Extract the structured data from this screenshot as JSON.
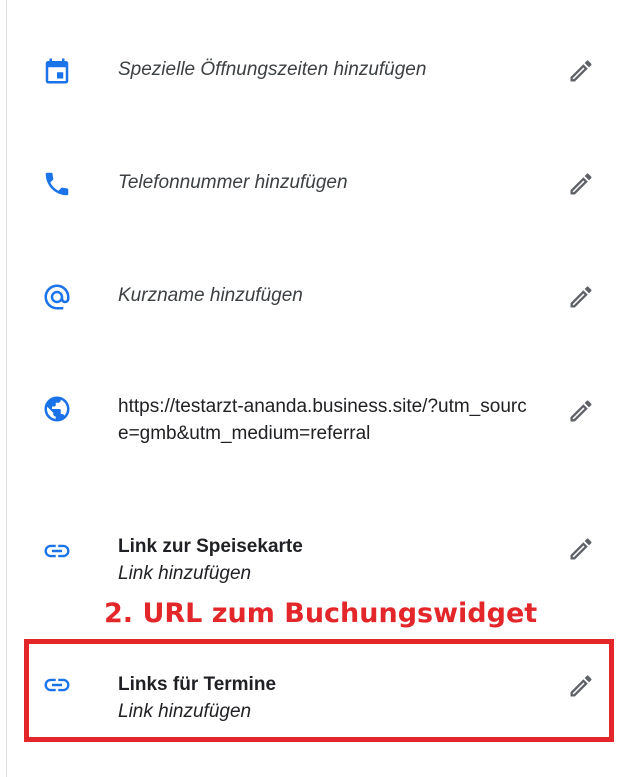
{
  "colors": {
    "icon_blue": "#1a73e8",
    "annotation_red": "#e3262a",
    "edit_gray": "#5f6368"
  },
  "rows": [
    {
      "icon": "calendar-icon",
      "text": "Spezielle Öffnungszeiten hinzufügen"
    },
    {
      "icon": "phone-icon",
      "text": "Telefonnummer hinzufügen"
    },
    {
      "icon": "at-sign-icon",
      "text": "Kurzname hinzufügen"
    },
    {
      "icon": "globe-icon",
      "text": "https://testarzt-ananda.business.site/?utm_source=gmb&utm_medium=referral"
    },
    {
      "icon": "link-icon",
      "title": "Link zur Speisekarte",
      "sub": "Link hinzufügen"
    },
    {
      "icon": "link-icon",
      "title": "Links für Termine",
      "sub": "Link hinzufügen"
    }
  ],
  "annotation": {
    "text": "2. URL zum Buchungswidget"
  }
}
